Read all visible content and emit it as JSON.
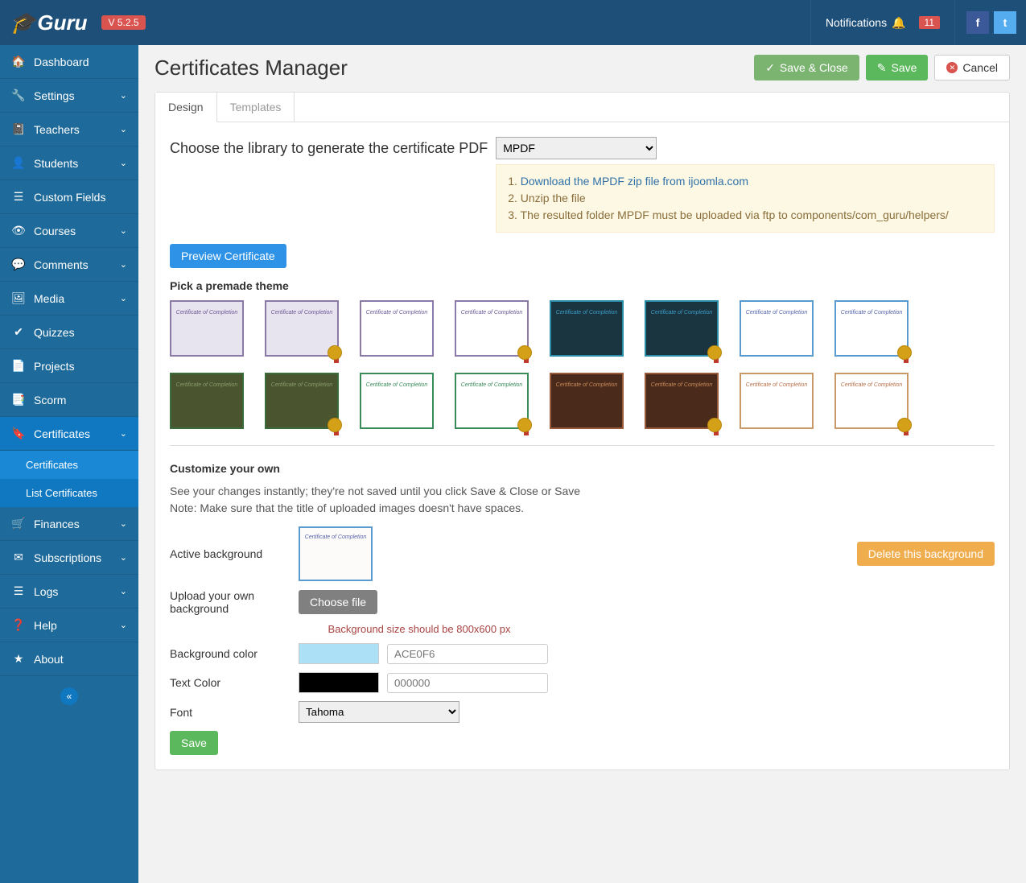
{
  "brand": {
    "name": "Guru",
    "version": "V 5.2.5"
  },
  "topbar": {
    "notifications_label": "Notifications",
    "notifications_count": "11"
  },
  "sidebar": {
    "items": [
      {
        "icon": "🏠",
        "label": "Dashboard",
        "chev": false
      },
      {
        "icon": "🔧",
        "label": "Settings",
        "chev": true
      },
      {
        "icon": "📓",
        "label": "Teachers",
        "chev": true
      },
      {
        "icon": "👤",
        "label": "Students",
        "chev": true
      },
      {
        "icon": "☰",
        "label": "Custom Fields",
        "chev": false
      },
      {
        "icon": "👁",
        "label": "Courses",
        "chev": true
      },
      {
        "icon": "💬",
        "label": "Comments",
        "chev": true
      },
      {
        "icon": "🖼",
        "label": "Media",
        "chev": true
      },
      {
        "icon": "✔",
        "label": "Quizzes",
        "chev": false
      },
      {
        "icon": "📄",
        "label": "Projects",
        "chev": false
      },
      {
        "icon": "📑",
        "label": "Scorm",
        "chev": false
      },
      {
        "icon": "🔖",
        "label": "Certificates",
        "chev": true,
        "active": true,
        "sub": [
          {
            "label": "Certificates",
            "active": true
          },
          {
            "label": "List Certificates"
          }
        ]
      },
      {
        "icon": "🛒",
        "label": "Finances",
        "chev": true
      },
      {
        "icon": "✉",
        "label": "Subscriptions",
        "chev": true
      },
      {
        "icon": "☰",
        "label": "Logs",
        "chev": true
      },
      {
        "icon": "❓",
        "label": "Help",
        "chev": true
      },
      {
        "icon": "★",
        "label": "About",
        "chev": false
      }
    ]
  },
  "page": {
    "title": "Certificates Manager",
    "actions": {
      "save_close": "Save & Close",
      "save": "Save",
      "cancel": "Cancel"
    }
  },
  "tabs": {
    "design": "Design",
    "templates": "Templates"
  },
  "lib": {
    "label": "Choose the library to generate the certificate PDF",
    "selected": "MPDF",
    "note1_prefix": "1. ",
    "note1_link": "Download the MPDF zip file from ijoomla.com",
    "note2": "2. Unzip the file",
    "note3": "3. The resulted folder MPDF must be uploaded via ftp to components/com_guru/helpers/"
  },
  "preview_btn": "Preview Certificate",
  "themes_title": "Pick a premade theme",
  "themes": [
    {
      "bg": "#e8e4ef",
      "border": "#8b7aa8",
      "text": "#6b5a98",
      "label": "Certificate of Completion",
      "badge": false
    },
    {
      "bg": "#e8e4ef",
      "border": "#8b7aa8",
      "text": "#6b5a98",
      "label": "Certificate of Completion",
      "badge": true
    },
    {
      "bg": "#ffffff",
      "border": "#8b7aa8",
      "text": "#6b5a98",
      "label": "Certificate of Completion",
      "badge": false
    },
    {
      "bg": "#ffffff",
      "border": "#8b7aa8",
      "text": "#6b5a98",
      "label": "Certificate of Completion",
      "badge": true
    },
    {
      "bg": "#1a3540",
      "border": "#2a8ba8",
      "text": "#3a9bc8",
      "label": "Certificate of Completion",
      "badge": false
    },
    {
      "bg": "#1a3540",
      "border": "#2a8ba8",
      "text": "#3a9bc8",
      "label": "Certificate of Completion",
      "badge": true
    },
    {
      "bg": "#ffffff",
      "border": "#5a9bcf",
      "text": "#5566aa",
      "label": "Certificate of Completion",
      "badge": false
    },
    {
      "bg": "#ffffff",
      "border": "#5a9bcf",
      "text": "#5566aa",
      "label": "Certificate of Completion",
      "badge": true
    },
    {
      "bg": "#4a5530",
      "border": "#3a6b3a",
      "text": "#8a9a6a",
      "label": "Certificate of Completion",
      "badge": false
    },
    {
      "bg": "#4a5530",
      "border": "#3a6b3a",
      "text": "#8a9a6a",
      "label": "Certificate of Completion",
      "badge": true
    },
    {
      "bg": "#ffffff",
      "border": "#3a8b5a",
      "text": "#3a8b5a",
      "label": "Certificate of Completion",
      "badge": false
    },
    {
      "bg": "#ffffff",
      "border": "#3a8b5a",
      "text": "#3a8b5a",
      "label": "Certificate of Completion",
      "badge": true
    },
    {
      "bg": "#4a2a1a",
      "border": "#9a5a3a",
      "text": "#c88a5a",
      "label": "Certificate of Completion",
      "badge": false
    },
    {
      "bg": "#4a2a1a",
      "border": "#9a5a3a",
      "text": "#c88a5a",
      "label": "Certificate of Completion",
      "badge": true
    },
    {
      "bg": "#ffffff",
      "border": "#c89a6a",
      "text": "#b8704a",
      "label": "Certificate of Completion",
      "badge": false
    },
    {
      "bg": "#ffffff",
      "border": "#c89a6a",
      "text": "#b8704a",
      "label": "Certificate of Completion",
      "badge": true
    }
  ],
  "customize": {
    "title": "Customize your own",
    "note_line1": "See your changes instantly; they're not saved until you click Save & Close or Save",
    "note_line2": "Note: Make sure that the title of uploaded images doesn't have spaces.",
    "active_bg_label": "Active background",
    "delete_bg": "Delete this background",
    "upload_label": "Upload your own background",
    "choose_file": "Choose file",
    "bg_hint": "Background size should be 800x600 px",
    "bg_color_label": "Background color",
    "bg_color_value": "ACE0F6",
    "text_color_label": "Text Color",
    "text_color_value": "000000",
    "font_label": "Font",
    "font_value": "Tahoma",
    "save_btn": "Save"
  }
}
